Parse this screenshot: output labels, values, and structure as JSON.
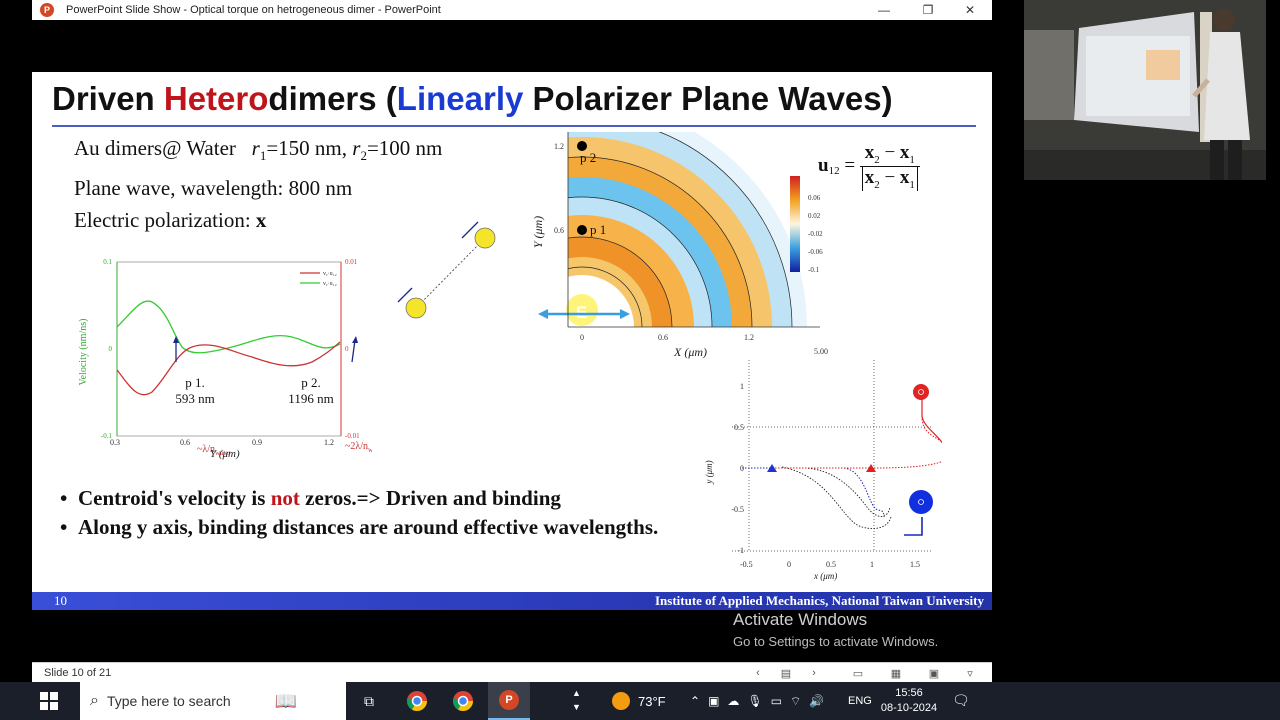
{
  "window": {
    "title": "PowerPoint Slide Show  -  Optical torque on hetrogeneous dimer - PowerPoint",
    "logo_letter": "P"
  },
  "slide": {
    "title_parts": [
      {
        "text": "Driven ",
        "color": "#111111"
      },
      {
        "text": "Hetero",
        "color": "#c0141b"
      },
      {
        "text": "dimers (",
        "color": "#111111"
      },
      {
        "text": "Linearly",
        "color": "#1a3bd1"
      },
      {
        "text": " Polarizer Plane Waves)",
        "color": "#111111"
      }
    ],
    "info_lines": {
      "line1_a": "Au dimers@ Water   ",
      "r1": "r",
      "r1_sub": "1",
      "r1_val": "=150 nm, ",
      "r2": "r",
      "r2_sub": "2",
      "r2_val": "=100 nm",
      "line2": "Plane wave, wavelength: 800 nm",
      "line3_a": "Electric polarization: ",
      "line3_b": "x"
    },
    "bullets": [
      {
        "pre": "Centroid's velocity is ",
        "highlight": "not",
        "post": " zeros.=> Driven and binding"
      },
      {
        "pre": "Along y axis, binding distances are around effective wavelengths.",
        "highlight": "",
        "post": ""
      }
    ],
    "footer": {
      "slide_number": "10",
      "institute": "Institute of Applied Mechanics, National Taiwan University"
    },
    "velocity_plot": {
      "ylabel": "Velocity (nm/ns)",
      "xlabel": "Y (μm)",
      "left_ticks": [
        "0.1",
        "0",
        "-0.1"
      ],
      "right_ticks": [
        "0.01",
        "0",
        "-0.01"
      ],
      "x_ticks": [
        "0.3",
        "0.6",
        "0.9",
        "1.2"
      ],
      "legend": [
        "vᵧ·u₁₂",
        "vᵧ·u₁₂"
      ],
      "p1_label": "p 1.",
      "p1_value": "593 nm",
      "p1_approx": "~λ/n",
      "p2_label": "p 2.",
      "p2_value": "1196 nm",
      "p2_approx": "~2λ/n",
      "water_sub": "water"
    },
    "field_map": {
      "y_ticks": [
        "1.2",
        "0.6"
      ],
      "x_ticks": [
        "0",
        "0.6",
        "1.2"
      ],
      "xlabel": "X (μm)",
      "ylabel": "Y (μm)",
      "p1": "p 1",
      "p2": "p 2",
      "E_label": "E",
      "colorbar_ticks": [
        "0.06",
        "0.02",
        "-0.02",
        "-0.06",
        "-0.1"
      ],
      "time_label": "5.00 ns"
    },
    "equation": {
      "lhs": "u",
      "lhs_sub": "12",
      "num_a": "x",
      "num_a_sub": "2",
      "num_b": "x",
      "num_b_sub": "1",
      "minus": " − ",
      "equals": " = "
    },
    "trajectory_plot": {
      "y_ticks": [
        "1",
        "0.5",
        "0",
        "-0.5",
        "-1"
      ],
      "x_ticks": [
        "-0.5",
        "0",
        "0.5",
        "1",
        "1.5"
      ],
      "xlabel": "x (μm)",
      "ylabel": "y (μm)"
    }
  },
  "activate": {
    "line1": "Activate Windows",
    "line2": "Go to Settings to activate Windows."
  },
  "statusbar": {
    "slide_info": "Slide 10 of 21"
  },
  "taskbar": {
    "search_placeholder": "Type here to search",
    "weather": "73°F",
    "lang": "ENG",
    "time": "15:56",
    "date": "08-10-2024"
  },
  "colors": {
    "title_accent_red": "#c0141b",
    "title_accent_blue": "#1a3bd1",
    "footer_blue": "#2a3ab8"
  }
}
